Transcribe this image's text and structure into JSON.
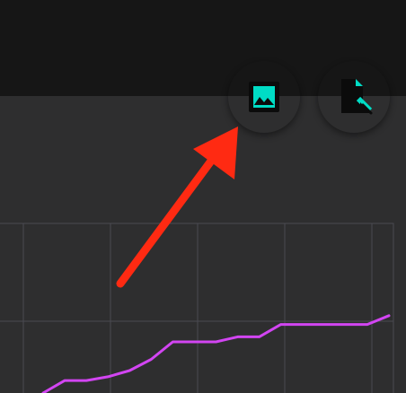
{
  "toolbar": {
    "image_button": {
      "icon": "image-icon"
    },
    "export_button": {
      "icon": "file-cursor-icon"
    }
  },
  "colors": {
    "top_bar": "#161616",
    "content_bg": "#2e2e2f",
    "accent": "#00dcc5",
    "icon": "#0b0b0b",
    "grid": "#4a4a52",
    "series": "#d245f2",
    "annotation_arrow": "#ff2a12"
  },
  "annotation": {
    "type": "arrow",
    "target": "image-button"
  },
  "chart_data": {
    "type": "line",
    "grid": true,
    "series": [
      {
        "values": [
          [
            1,
            0
          ],
          [
            2,
            1.0
          ],
          [
            3,
            1.0
          ],
          [
            4,
            1.3
          ],
          [
            5,
            1.8
          ],
          [
            6,
            2.7
          ],
          [
            7,
            4.1
          ],
          [
            8,
            4.1
          ],
          [
            9,
            4.1
          ],
          [
            10,
            4.5
          ],
          [
            11,
            4.5
          ],
          [
            12,
            5.5
          ],
          [
            13,
            5.5
          ],
          [
            14,
            5.5
          ],
          [
            15,
            5.5
          ],
          [
            16,
            5.5
          ],
          [
            17,
            6.2
          ]
        ]
      }
    ]
  }
}
